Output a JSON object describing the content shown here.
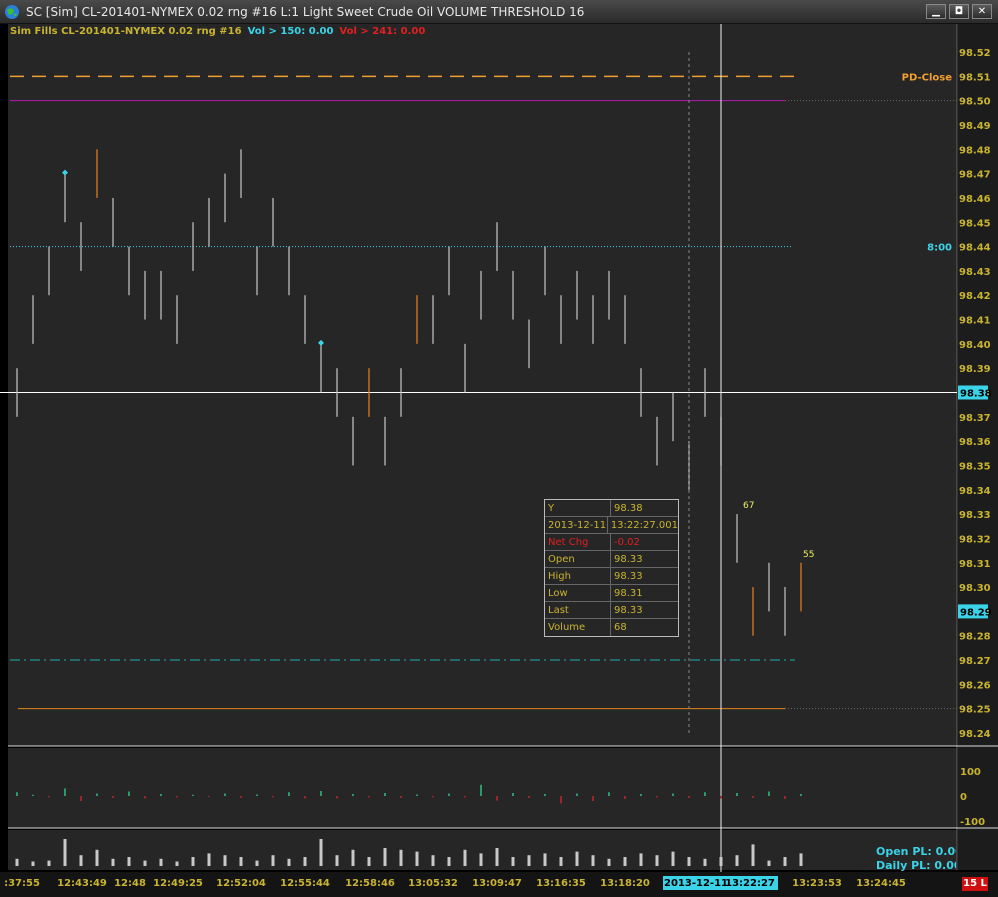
{
  "window": {
    "title": "SC [Sim] CL-201401-NYMEX  0.02 rng  #16  L:1  Light Sweet Crude Oil  VOLUME THRESHOLD 16",
    "min_label": "▁",
    "max_label": "◘",
    "close_label": "✕"
  },
  "info_strip": {
    "study": "Sim Fills  CL-201401-NYMEX  0.02 rng  #16",
    "vol_high": "Vol > 150: 0.00",
    "vol_low": "Vol > 241: 0.00"
  },
  "colors": {
    "background": "#262626",
    "axis_text": "#c8b430",
    "cyan": "#3ad3e8",
    "orange": "#e8821e",
    "red": "#e02020",
    "magenta": "#b01cb0",
    "price_line": "#ffffff"
  },
  "ref_lines": {
    "pd_close": "PD-Close",
    "eight_oclock": "8:00"
  },
  "chart_data": {
    "type": "bar",
    "y_ticks": [
      "98.52",
      "98.51",
      "98.50",
      "98.49",
      "98.48",
      "98.47",
      "98.46",
      "98.45",
      "98.44",
      "98.43",
      "98.42",
      "98.41",
      "98.40",
      "98.39",
      "98.38",
      "98.37",
      "98.36",
      "98.35",
      "98.34",
      "98.33",
      "98.32",
      "98.31",
      "98.30",
      "98.29",
      "98.28",
      "98.27",
      "98.26",
      "98.25",
      "98.24"
    ],
    "ylim": [
      98.235,
      98.525
    ],
    "current_price": "98.38",
    "last_price": "98.29",
    "bars": [
      {
        "low": 98.37,
        "high": 98.39,
        "color": "white"
      },
      {
        "low": 98.4,
        "high": 98.42,
        "color": "white"
      },
      {
        "low": 98.42,
        "high": 98.44,
        "color": "white"
      },
      {
        "low": 98.45,
        "high": 98.47,
        "color": "white",
        "marker": true
      },
      {
        "low": 98.43,
        "high": 98.45,
        "color": "white"
      },
      {
        "low": 98.46,
        "high": 98.48,
        "color": "orange"
      },
      {
        "low": 98.44,
        "high": 98.46,
        "color": "white"
      },
      {
        "low": 98.42,
        "high": 98.44,
        "color": "white"
      },
      {
        "low": 98.41,
        "high": 98.43,
        "color": "white"
      },
      {
        "low": 98.41,
        "high": 98.43,
        "color": "white"
      },
      {
        "low": 98.4,
        "high": 98.42,
        "color": "white"
      },
      {
        "low": 98.43,
        "high": 98.45,
        "color": "white"
      },
      {
        "low": 98.44,
        "high": 98.46,
        "color": "white"
      },
      {
        "low": 98.45,
        "high": 98.47,
        "color": "white"
      },
      {
        "low": 98.46,
        "high": 98.48,
        "color": "white"
      },
      {
        "low": 98.42,
        "high": 98.44,
        "color": "white"
      },
      {
        "low": 98.44,
        "high": 98.46,
        "color": "white"
      },
      {
        "low": 98.42,
        "high": 98.44,
        "color": "white"
      },
      {
        "low": 98.4,
        "high": 98.42,
        "color": "white"
      },
      {
        "low": 98.38,
        "high": 98.4,
        "color": "white",
        "marker": true
      },
      {
        "low": 98.37,
        "high": 98.39,
        "color": "white"
      },
      {
        "low": 98.35,
        "high": 98.37,
        "color": "white"
      },
      {
        "low": 98.37,
        "high": 98.39,
        "color": "orange"
      },
      {
        "low": 98.35,
        "high": 98.37,
        "color": "white"
      },
      {
        "low": 98.37,
        "high": 98.39,
        "color": "white"
      },
      {
        "low": 98.4,
        "high": 98.42,
        "color": "orange"
      },
      {
        "low": 98.4,
        "high": 98.42,
        "color": "white"
      },
      {
        "low": 98.42,
        "high": 98.44,
        "color": "white"
      },
      {
        "low": 98.38,
        "high": 98.4,
        "color": "white"
      },
      {
        "low": 98.41,
        "high": 98.43,
        "color": "white"
      },
      {
        "low": 98.43,
        "high": 98.45,
        "color": "white"
      },
      {
        "low": 98.41,
        "high": 98.43,
        "color": "white"
      },
      {
        "low": 98.39,
        "high": 98.41,
        "color": "white"
      },
      {
        "low": 98.42,
        "high": 98.44,
        "color": "white"
      },
      {
        "low": 98.4,
        "high": 98.42,
        "color": "white"
      },
      {
        "low": 98.41,
        "high": 98.43,
        "color": "white"
      },
      {
        "low": 98.4,
        "high": 98.42,
        "color": "white"
      },
      {
        "low": 98.41,
        "high": 98.43,
        "color": "white"
      },
      {
        "low": 98.4,
        "high": 98.42,
        "color": "white"
      },
      {
        "low": 98.37,
        "high": 98.39,
        "color": "white"
      },
      {
        "low": 98.35,
        "high": 98.37,
        "color": "white"
      },
      {
        "low": 98.36,
        "high": 98.38,
        "color": "white"
      },
      {
        "low": 98.34,
        "high": 98.36,
        "color": "white"
      },
      {
        "low": 98.37,
        "high": 98.39,
        "color": "white"
      },
      {
        "low": 98.35,
        "high": 98.37,
        "color": "white"
      },
      {
        "low": 98.31,
        "high": 98.33,
        "color": "white"
      },
      {
        "low": 98.28,
        "high": 98.3,
        "color": "orange"
      },
      {
        "low": 98.29,
        "high": 98.31,
        "color": "white"
      },
      {
        "low": 98.28,
        "high": 98.3,
        "color": "white"
      },
      {
        "low": 98.29,
        "high": 98.31,
        "color": "orange"
      }
    ],
    "bar_labels": [
      {
        "bar": 45,
        "text": "67"
      },
      {
        "bar": 49,
        "text": "55"
      }
    ],
    "delta_ticks": [
      "100",
      "0",
      "-100"
    ],
    "delta": [
      15,
      5,
      -5,
      30,
      -20,
      10,
      -8,
      18,
      -10,
      8,
      -6,
      5,
      -4,
      10,
      -7,
      6,
      -5,
      15,
      -10,
      20,
      -10,
      8,
      -6,
      12,
      -8,
      6,
      -5,
      10,
      -6,
      45,
      -18,
      12,
      -8,
      8,
      -30,
      10,
      -20,
      15,
      -12,
      8,
      -6,
      10,
      -8,
      15,
      -10,
      12,
      -8,
      18,
      -12,
      8
    ],
    "volume": [
      8,
      5,
      6,
      30,
      12,
      18,
      8,
      10,
      6,
      8,
      5,
      10,
      14,
      12,
      10,
      6,
      12,
      8,
      10,
      30,
      12,
      18,
      10,
      20,
      18,
      16,
      12,
      10,
      18,
      14,
      20,
      10,
      12,
      14,
      10,
      16,
      12,
      8,
      10,
      14,
      12,
      16,
      10,
      8,
      10,
      12,
      24,
      6,
      10,
      14
    ],
    "x_ticks": [
      ":37:55",
      "12:43:49",
      "12:48",
      "12:49:25",
      "12:52:04",
      "12:55:44",
      "12:58:46",
      "13:05:32",
      "13:09:47",
      "13:16:35",
      "13:18:20",
      "13:23:53",
      "13:24:45"
    ],
    "cursor_date": "2013-12-11",
    "cursor_time": "13:22:27"
  },
  "data_box": {
    "y_label": "Y",
    "y_value": "98.38",
    "date": "2013-12-11",
    "time": "13:22:27.001",
    "netchg_label": "Net Chg",
    "netchg_value": "-0.02",
    "open_label": "Open",
    "open_value": "98.33",
    "high_label": "High",
    "high_value": "98.33",
    "low_label": "Low",
    "low_value": "98.31",
    "last_label": "Last",
    "last_value": "98.33",
    "volume_label": "Volume",
    "volume_value": "68"
  },
  "pl": {
    "open_pl": "Open PL: 0.00",
    "daily_pl": "Daily PL: 0.00"
  },
  "badge": "15 L"
}
